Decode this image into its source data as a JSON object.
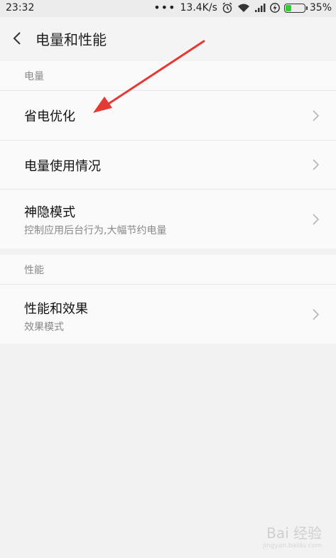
{
  "status_bar": {
    "time": "23:32",
    "speed": "13.4K/s",
    "battery": "35%",
    "battery_level": 0.35,
    "battery_color": "#33cc33"
  },
  "header": {
    "title": "电量和性能"
  },
  "sections": [
    {
      "header": "电量",
      "items": [
        {
          "title": "省电优化",
          "subtitle": ""
        },
        {
          "title": "电量使用情况",
          "subtitle": ""
        },
        {
          "title": "神隐模式",
          "subtitle": "控制应用后台行为,大幅节约电量"
        }
      ]
    },
    {
      "header": "性能",
      "items": [
        {
          "title": "性能和效果",
          "subtitle": "效果模式"
        }
      ]
    }
  ],
  "annotation": {
    "arrow_color": "#e53935"
  },
  "watermark": {
    "brand": "Bai 经验",
    "url": "jingyan.baidu.com"
  }
}
